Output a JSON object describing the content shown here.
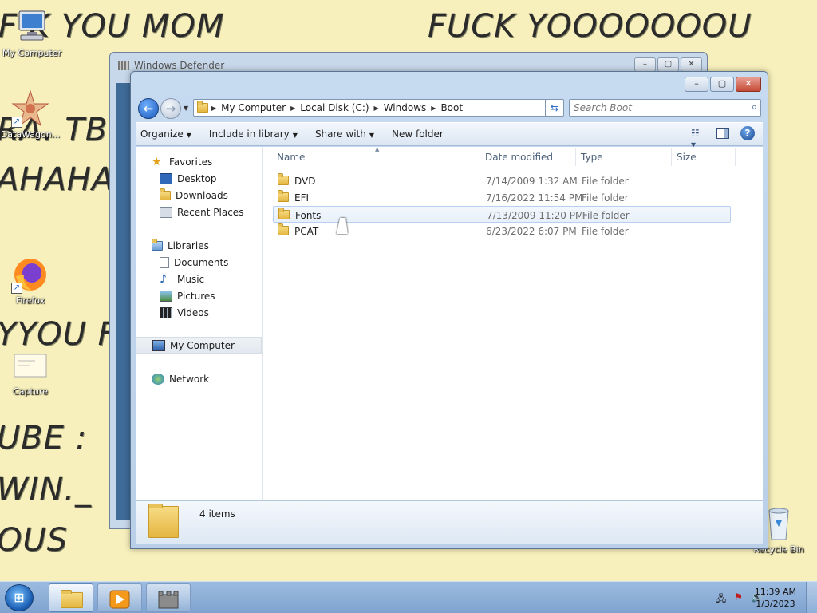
{
  "wallpaper": {
    "lines": [
      "F  K YOU MOM",
      "FUCK YOOOOOOOU",
      "RA. TBC",
      "AHAHAH",
      "YYOU F",
      "UBE :",
      "WIN._",
      "OUS"
    ]
  },
  "desktop_icons": [
    {
      "label": "My Computer",
      "icon": "computer-icon"
    },
    {
      "label": "DataWagon...",
      "icon": "datawagon-icon"
    },
    {
      "label": "Firefox",
      "icon": "firefox-icon"
    },
    {
      "label": "Capture",
      "icon": "image-file-icon"
    },
    {
      "label": "Recycle Bin",
      "icon": "recycle-bin-icon"
    }
  ],
  "defender_window": {
    "title": "Windows Defender"
  },
  "explorer": {
    "address": {
      "crumbs": [
        "My Computer",
        "Local Disk (C:)",
        "Windows",
        "Boot"
      ]
    },
    "search": {
      "placeholder": "Search Boot"
    },
    "toolbar": {
      "organize": "Organize",
      "include_in_library": "Include in library",
      "share_with": "Share with",
      "new_folder": "New folder"
    },
    "nav": {
      "favorites": "Favorites",
      "desktop": "Desktop",
      "downloads": "Downloads",
      "recent_places": "Recent Places",
      "libraries": "Libraries",
      "documents": "Documents",
      "music": "Music",
      "pictures": "Pictures",
      "videos": "Videos",
      "my_computer": "My Computer",
      "network": "Network"
    },
    "columns": {
      "name": "Name",
      "date_modified": "Date modified",
      "type": "Type",
      "size": "Size"
    },
    "files": [
      {
        "name": "DVD",
        "date": "7/14/2009 1:32 AM",
        "type": "File folder"
      },
      {
        "name": "EFI",
        "date": "7/16/2022 11:54 PM",
        "type": "File folder"
      },
      {
        "name": "Fonts",
        "date": "7/13/2009 11:20 PM",
        "type": "File folder"
      },
      {
        "name": "PCAT",
        "date": "6/23/2022 6:07 PM",
        "type": "File folder"
      }
    ],
    "status": {
      "item_count": "4 items"
    }
  },
  "taskbar": {
    "clock_time": "11:39 AM",
    "clock_date": "1/3/2023"
  }
}
